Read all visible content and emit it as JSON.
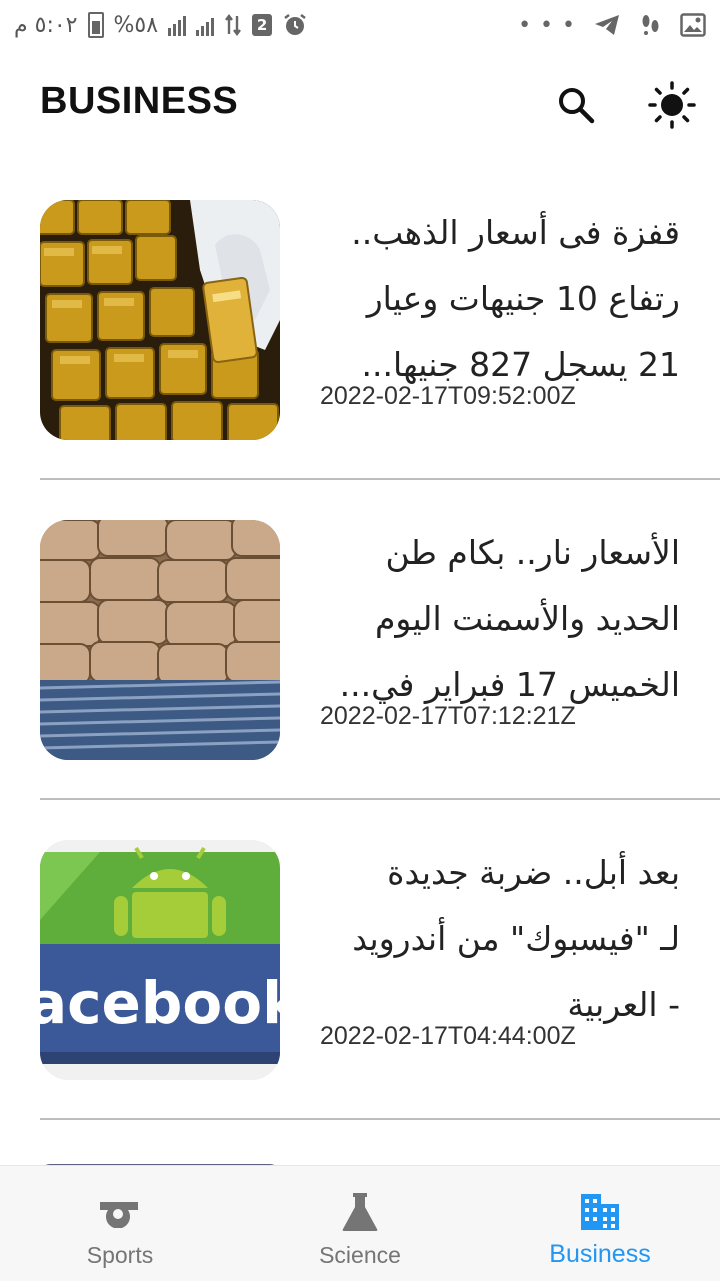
{
  "status_bar": {
    "time": "٥:٠٢ م",
    "battery_percent": "%٥٨",
    "notification_count": "2"
  },
  "app_bar": {
    "title": "BUSINESS",
    "search_icon": "search-icon",
    "theme_icon": "sun-icon"
  },
  "articles": [
    {
      "title_lines": [
        "قفزة فى أسعار الذهب..",
        "رتفاع 10 جنيهات وعيار",
        "21 يسجل 827 جنيها..."
      ],
      "published_at": "2022-02-17T09:52:00Z",
      "thumbnail": "gold-bars-image"
    },
    {
      "title_lines": [
        "الأسعار نار.. بكام طن",
        "الحديد والأسمنت اليوم",
        "الخميس 17 فبراير في..."
      ],
      "published_at": "2022-02-17T07:12:21Z",
      "thumbnail": "cement-steel-image"
    },
    {
      "title_lines": [
        "بعد أبل.. ضربة جديدة",
        "لـ \"فيسبوك\" من أندرويد",
        "- العربية"
      ],
      "published_at": "2022-02-17T04:44:00Z",
      "thumbnail": "android-facebook-image"
    }
  ],
  "bottom_nav": {
    "items": [
      {
        "label": "Sports",
        "icon": "whistle-icon"
      },
      {
        "label": "Science",
        "icon": "flask-icon"
      },
      {
        "label": "Business",
        "icon": "business-building-icon"
      }
    ],
    "active_index": 2,
    "active_color": "#2196f3",
    "inactive_color": "#757575"
  }
}
